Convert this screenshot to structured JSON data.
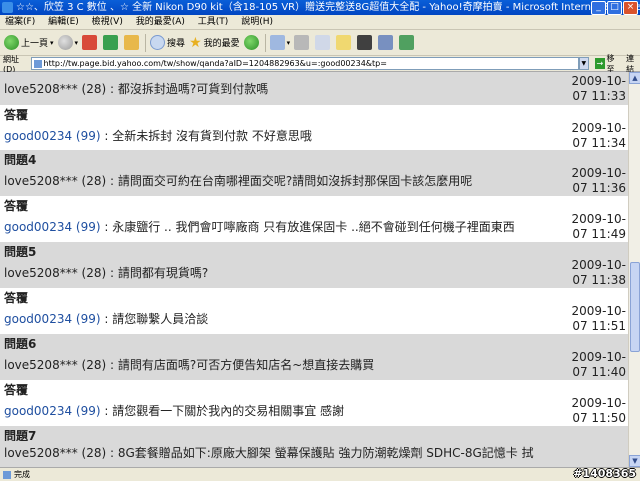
{
  "window": {
    "title": "☆☆、欣笠 3 C 數位 、☆ 全新 Nikon D90 kit（含18-105 VR）贈送完整送8G超值大全配 - Yahoo!奇摩拍賣 - Microsoft Internet Explorer",
    "controls": {
      "minimize": "_",
      "maximize": "□",
      "close": "×"
    }
  },
  "menubar": {
    "items": [
      "檔案(F)",
      "編輯(E)",
      "檢視(V)",
      "我的最愛(A)",
      "工具(T)",
      "說明(H)"
    ]
  },
  "toolbar": {
    "back_label": "上一頁",
    "search_label": "搜尋",
    "favorites_label": "我的最愛",
    "icons": [
      "back-icon",
      "forward-icon",
      "stop-icon",
      "refresh-icon",
      "home-icon",
      "search-icon",
      "favorites-icon",
      "history-icon",
      "mail-icon",
      "print-icon",
      "edit-icon",
      "folder-icon",
      "messenger-icon",
      "research-icon",
      "tools-icon"
    ]
  },
  "address": {
    "label": "網址(D)",
    "url": "http://tw.page.bid.yahoo.com/tw/show/qanda?aID=1204882963&u=:good00234&tp=",
    "go_label": "移至",
    "links_label": "連結"
  },
  "qa": [
    {
      "type": "q",
      "user": "love5208***",
      "score": "(28)",
      "text": "都沒拆封過嗎?可貨到付款嗎",
      "date": "2009-10-",
      "time": "07 11:33"
    },
    {
      "type": "header",
      "text": "答覆"
    },
    {
      "type": "a",
      "user": "good00234",
      "score": "(99)",
      "text": "全新未拆封 沒有貨到付款 不好意思哦",
      "date": "2009-10-",
      "time": "07 11:34"
    },
    {
      "type": "header",
      "text": "問題4"
    },
    {
      "type": "q",
      "user": "love5208***",
      "score": "(28)",
      "text": "請問面交可約在台南哪裡面交呢?請問如沒拆封那保固卡該怎麼用呢",
      "date": "2009-10-",
      "time": "07 11:36"
    },
    {
      "type": "header",
      "text": "答覆"
    },
    {
      "type": "a",
      "user": "good00234",
      "score": "(99)",
      "text": "永康鹽行 .. 我們會叮嚀廠商 只有放進保固卡 ..絕不會碰到任何機子裡面東西",
      "date": "2009-10-",
      "time": "07 11:49"
    },
    {
      "type": "header",
      "text": "問題5"
    },
    {
      "type": "q",
      "user": "love5208***",
      "score": "(28)",
      "text": "請問都有現貨嗎?",
      "date": "2009-10-",
      "time": "07 11:38"
    },
    {
      "type": "header",
      "text": "答覆"
    },
    {
      "type": "a",
      "user": "good00234",
      "score": "(99)",
      "text": "請您聯繫人員洽談",
      "date": "2009-10-",
      "time": "07 11:51"
    },
    {
      "type": "header",
      "text": "問題6"
    },
    {
      "type": "q",
      "user": "love5208***",
      "score": "(28)",
      "text": "請問有店面嗎?可否方便告知店名~想直接去購買",
      "date": "2009-10-",
      "time": "07 11:40"
    },
    {
      "type": "header",
      "text": "答覆"
    },
    {
      "type": "a",
      "user": "good00234",
      "score": "(99)",
      "text": "請您觀看一下關於我內的交易相關事宜 感謝",
      "date": "2009-10-",
      "time": "07 11:50"
    },
    {
      "type": "header",
      "text": "問題7"
    },
    {
      "type": "q",
      "user": "love5208***",
      "score": "(28)",
      "text": "8G套餐贈品如下:原廠大腳架 螢幕保護貼 強力防潮乾燥劑 SDHC-8G記憶卡 拭",
      "date": "",
      "time": ""
    }
  ],
  "status": {
    "text": "完成",
    "watermark": "#1408365"
  }
}
